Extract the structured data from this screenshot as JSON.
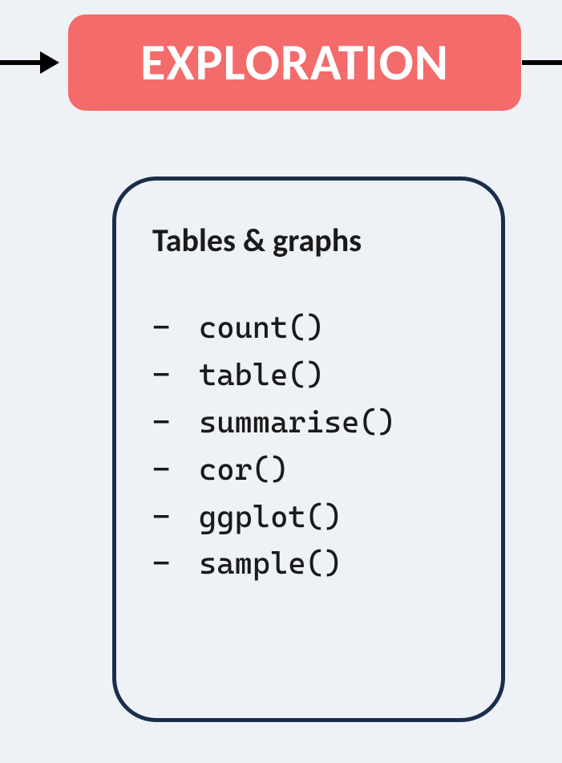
{
  "header": {
    "title": "EXPLORATION"
  },
  "content": {
    "section_title": "Tables & graphs",
    "bullet": "-",
    "functions": [
      "count()",
      "table()",
      "summarise()",
      "cor()",
      "ggplot()",
      "sample()"
    ]
  }
}
